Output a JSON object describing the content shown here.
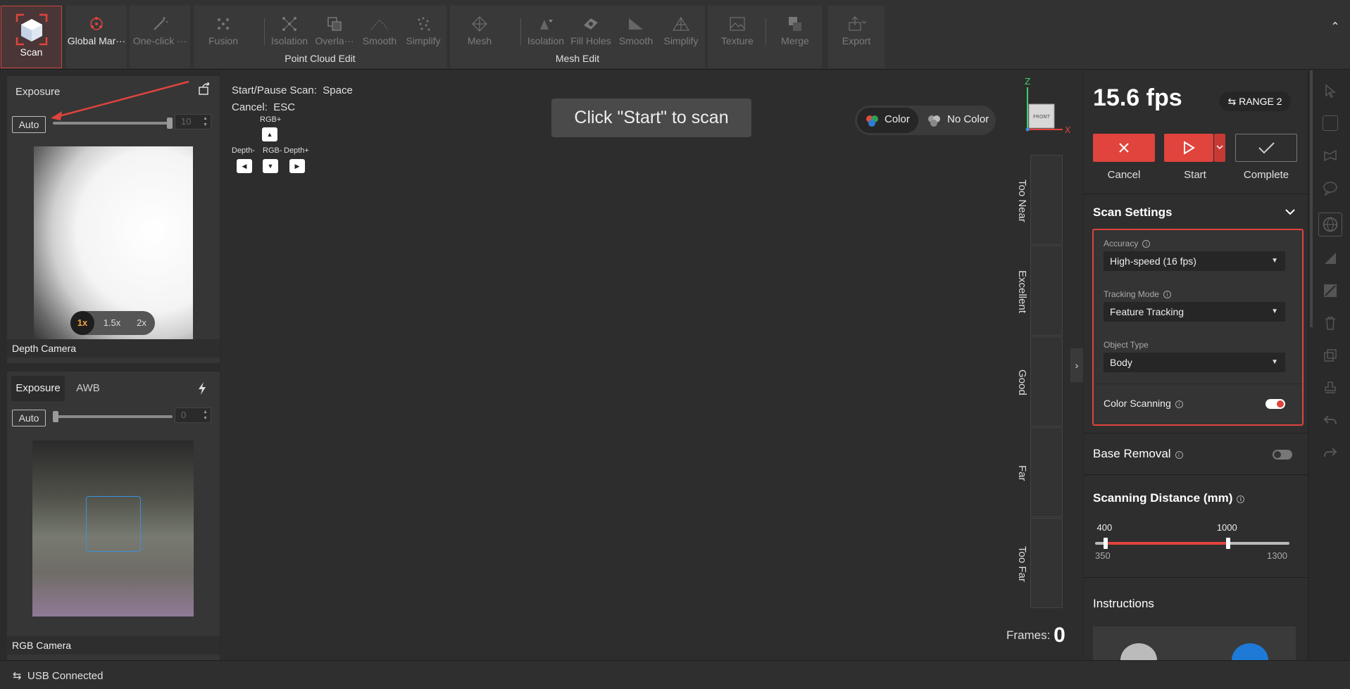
{
  "toolbar": {
    "scan_label": "Scan",
    "global_markers_label": "Global Mar···",
    "one_click_label": "One-click ···",
    "point_cloud": {
      "group_label": "Point Cloud Edit",
      "items": [
        "Fusion",
        "Isolation",
        "Overla···",
        "Smooth",
        "Simplify"
      ]
    },
    "mesh": {
      "group_label": "Mesh Edit",
      "items": [
        "Mesh",
        "Isolation",
        "Fill Holes",
        "Smooth",
        "Simplify"
      ]
    },
    "texture_label": "Texture",
    "merge_label": "Merge",
    "export_label": "Export",
    "collapse_icon": "chevron-up-icon"
  },
  "depth_camera": {
    "section_title": "Exposure",
    "auto_label": "Auto",
    "exposure_value": "10",
    "exposure_level": 1.0,
    "zoom_options": [
      "1x",
      "1.5x",
      "2x"
    ],
    "zoom_selected": "1x",
    "caption": "Depth Camera"
  },
  "rgb_camera": {
    "tabs": [
      "Exposure",
      "AWB"
    ],
    "active_tab": "Exposure",
    "auto_label": "Auto",
    "exposure_value": "0",
    "exposure_level": 0.0,
    "caption": "RGB Camera"
  },
  "viewport": {
    "hint_start_pause": "Start/Pause Scan:",
    "hint_start_pause_key": "Space",
    "hint_cancel": "Cancel:",
    "hint_cancel_key": "ESC",
    "key_labels": {
      "rgb_plus": "RGB+",
      "depth_minus": "Depth-",
      "rgb_minus": "RGB-",
      "depth_plus": "Depth+"
    },
    "start_prompt": "Click \"Start\" to scan",
    "color_mode": {
      "color_label": "Color",
      "no_color_label": "No Color",
      "selected": "Color"
    },
    "axis": {
      "z": "Z",
      "x": "X",
      "cube_face": "FRONT"
    },
    "distance_levels": [
      "Too Near",
      "Excellent",
      "Good",
      "Far",
      "Too Far"
    ],
    "frames_label": "Frames:",
    "frames_value": "0"
  },
  "right_panel": {
    "fps": "15.6 fps",
    "device_badge": "RANGE 2",
    "actions": {
      "cancel": "Cancel",
      "start": "Start",
      "complete": "Complete"
    },
    "scan_settings": {
      "title": "Scan Settings",
      "accuracy_label": "Accuracy",
      "accuracy_value": "High-speed (16 fps)",
      "tracking_label": "Tracking Mode",
      "tracking_value": "Feature Tracking",
      "object_type_label": "Object Type",
      "object_type_value": "Body",
      "color_scanning_label": "Color Scanning",
      "color_scanning_on": true
    },
    "base_removal": {
      "label": "Base Removal",
      "on": false
    },
    "scanning_distance": {
      "title": "Scanning Distance (mm)",
      "low": "400",
      "high": "1000",
      "min": "350",
      "max": "1300",
      "low_value": 400,
      "high_value": 1000,
      "min_value": 350,
      "max_value": 1300
    },
    "instructions_title": "Instructions"
  },
  "status": {
    "usb": "USB Connected"
  },
  "colors": {
    "accent": "#e0443c",
    "focus": "#3b8fe0",
    "zoom_active": "#f4a43a"
  }
}
